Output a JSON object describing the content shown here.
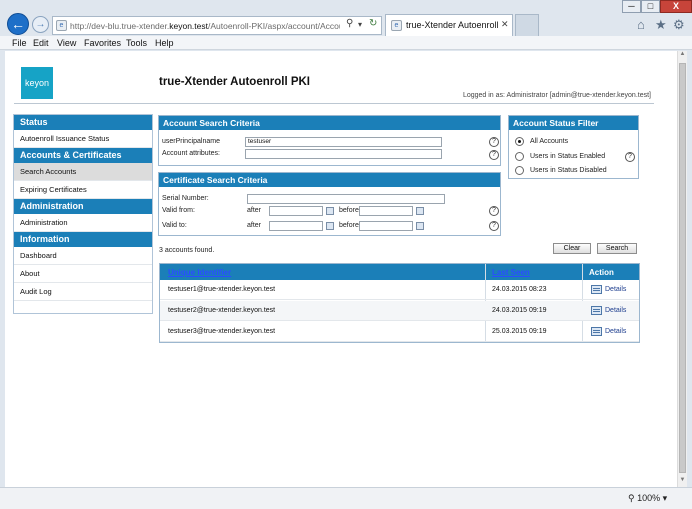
{
  "browser": {
    "address": {
      "url_prefix": "http://dev-blu.true-xtender.",
      "url_domain": "keyon.test",
      "url_path": "/Autoenroll-PKI/aspx/account/AccountSe"
    },
    "tab": {
      "title": "true-Xtender Autoenroll PKI..."
    },
    "window_controls": {
      "minimize": "─",
      "maximize": "□",
      "close": "X"
    },
    "menu": [
      "File",
      "Edit",
      "View",
      "Favorites",
      "Tools",
      "Help"
    ],
    "zoom": "100%"
  },
  "header": {
    "logo_text": "keyon",
    "app_title": "true-Xtender Autoenroll PKI",
    "logged_in": "Logged in as: Administrator [admin@true-xtender.keyon.test]"
  },
  "sidebar": {
    "sections": [
      {
        "title": "Status",
        "items": [
          {
            "label": "Autoenroll Issuance Status"
          }
        ]
      },
      {
        "title": "Accounts & Certificates",
        "items": [
          {
            "label": "Search Accounts"
          },
          {
            "label": "Expiring Certificates"
          }
        ]
      },
      {
        "title": "Administration",
        "items": [
          {
            "label": "Administration"
          }
        ]
      },
      {
        "title": "Information",
        "items": [
          {
            "label": "Dashboard"
          },
          {
            "label": "About"
          },
          {
            "label": "Audit Log"
          }
        ]
      }
    ]
  },
  "account_search": {
    "title": "Account Search Criteria",
    "upn_label": "userPrincipalname",
    "upn_value": "testuser",
    "attributes_label": "Account attributes:",
    "attributes_value": ""
  },
  "cert_search": {
    "title": "Certificate Search Criteria",
    "serial_label": "Serial Number:",
    "valid_from_label": "Valid from:",
    "valid_to_label": "Valid to:",
    "after_label": "after",
    "before_label": "before"
  },
  "status_filter": {
    "title": "Account Status Filter",
    "options": [
      "All Accounts",
      "Users in Status Enabled",
      "Users in Status Disabled"
    ],
    "selected": "All Accounts"
  },
  "results": {
    "count_text": "3 accounts found.",
    "clear_label": "Clear",
    "search_label": "Search",
    "columns": {
      "identifier": "Unique Identifier",
      "last_seen": "Last Seen",
      "action": "Action"
    },
    "rows": [
      {
        "identifier": "testuser1@true-xtender.keyon.test",
        "last_seen": "24.03.2015 08:23",
        "action": "Details"
      },
      {
        "identifier": "testuser2@true-xtender.keyon.test",
        "last_seen": "24.03.2015 09:19",
        "action": "Details"
      },
      {
        "identifier": "testuser3@true-xtender.keyon.test",
        "last_seen": "25.03.2015 09:19",
        "action": "Details"
      }
    ]
  },
  "help_symbol": "?"
}
